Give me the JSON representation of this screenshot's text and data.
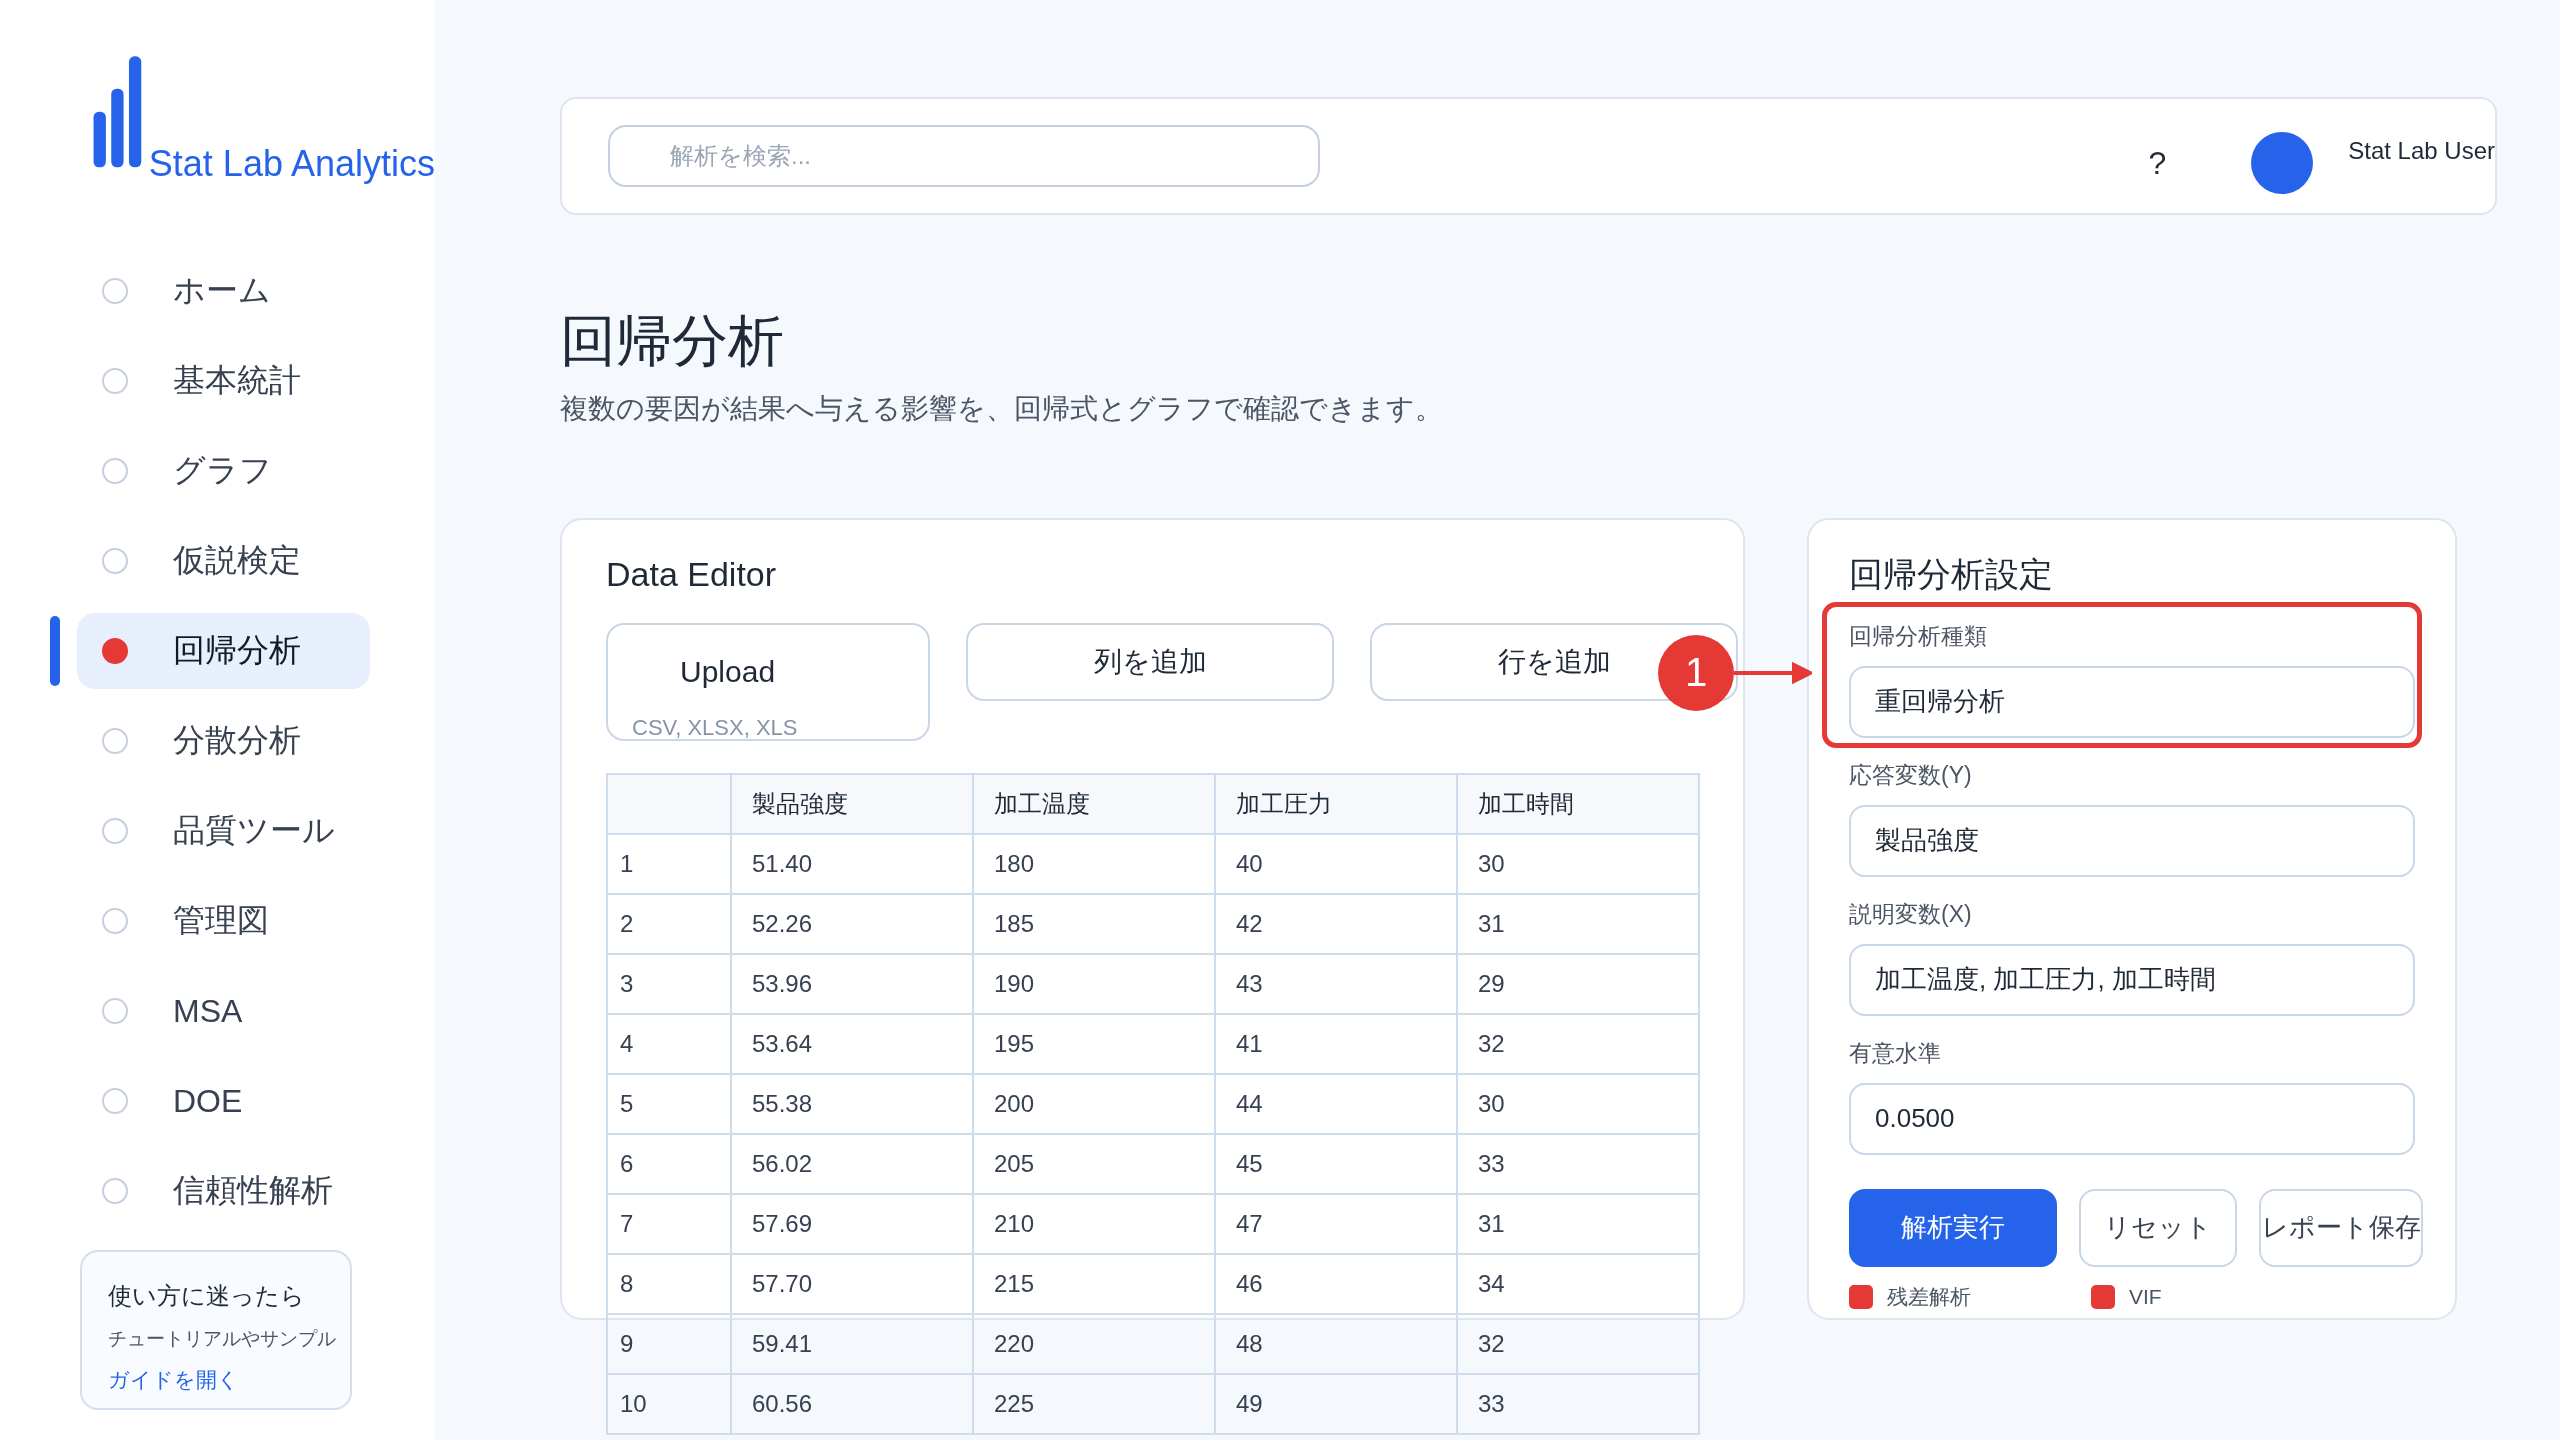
{
  "brand": {
    "name": "Stat Lab Analytics"
  },
  "sidebar": {
    "items": [
      {
        "label": "ホーム",
        "selected": false
      },
      {
        "label": "基本統計",
        "selected": false
      },
      {
        "label": "グラフ",
        "selected": false
      },
      {
        "label": "仮説検定",
        "selected": false
      },
      {
        "label": "回帰分析",
        "selected": true
      },
      {
        "label": "分散分析",
        "selected": false
      },
      {
        "label": "品質ツール",
        "selected": false
      },
      {
        "label": "管理図",
        "selected": false
      },
      {
        "label": "MSA",
        "selected": false
      },
      {
        "label": "DOE",
        "selected": false
      },
      {
        "label": "信頼性解析",
        "selected": false
      }
    ],
    "help": {
      "title": "使い方に迷ったら",
      "text": "チュートリアルやサンプル",
      "link": "ガイドを開く"
    }
  },
  "header": {
    "search": {
      "placeholder": "解析を検索..."
    },
    "help": "?",
    "user": "Stat Lab User"
  },
  "page": {
    "title": "回帰分析",
    "subtitle": "複数の要因が結果へ与える影響を、回帰式とグラフで確認できます。"
  },
  "data_editor": {
    "title": "Data Editor",
    "upload": {
      "label": "Upload",
      "formats": "CSV, XLSX, XLS"
    },
    "buttons": [
      "列を追加",
      "行を追加"
    ],
    "table": {
      "columns": [
        "",
        "製品強度",
        "加工温度",
        "加工圧力",
        "加工時間"
      ],
      "rows": [
        [
          "1",
          "51.40",
          "180",
          "40",
          "30"
        ],
        [
          "2",
          "52.26",
          "185",
          "42",
          "31"
        ],
        [
          "3",
          "53.96",
          "190",
          "43",
          "29"
        ],
        [
          "4",
          "53.64",
          "195",
          "41",
          "32"
        ],
        [
          "5",
          "55.38",
          "200",
          "44",
          "30"
        ],
        [
          "6",
          "56.02",
          "205",
          "45",
          "33"
        ],
        [
          "7",
          "57.69",
          "210",
          "47",
          "31"
        ],
        [
          "8",
          "57.70",
          "215",
          "46",
          "34"
        ],
        [
          "9",
          "59.41",
          "220",
          "48",
          "32"
        ],
        [
          "10",
          "60.56",
          "225",
          "49",
          "33"
        ]
      ]
    }
  },
  "settings": {
    "title": "回帰分析設定",
    "fields": [
      {
        "label": "回帰分析種類",
        "value": "重回帰分析"
      },
      {
        "label": "応答変数(Y)",
        "value": "製品強度"
      },
      {
        "label": "説明変数(X)",
        "value": "加工温度, 加工圧力, 加工時間"
      },
      {
        "label": "有意水準",
        "value": "0.0500"
      }
    ],
    "buttons": [
      {
        "label": "解析実行",
        "kind": "primary"
      },
      {
        "label": "リセット",
        "kind": "secondary"
      },
      {
        "label": "レポート保存",
        "kind": "secondary"
      }
    ],
    "options": [
      {
        "label": "残差解析",
        "checked": true
      },
      {
        "label": "VIF",
        "checked": true
      }
    ]
  },
  "callout": {
    "number": "1"
  }
}
